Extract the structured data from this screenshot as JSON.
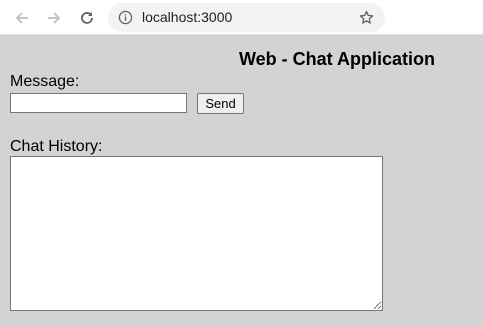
{
  "browser": {
    "url": "localhost:3000",
    "icons": {
      "back": "arrow-left-icon",
      "forward": "arrow-right-icon",
      "reload": "reload-icon",
      "site_info": "info-icon",
      "bookmark": "star-icon"
    }
  },
  "page": {
    "title": "Web - Chat Application",
    "background": "#d3d3d3",
    "message_label": "Message:",
    "message_value": "",
    "send_label": "Send",
    "history_label": "Chat History:",
    "history_value": ""
  }
}
